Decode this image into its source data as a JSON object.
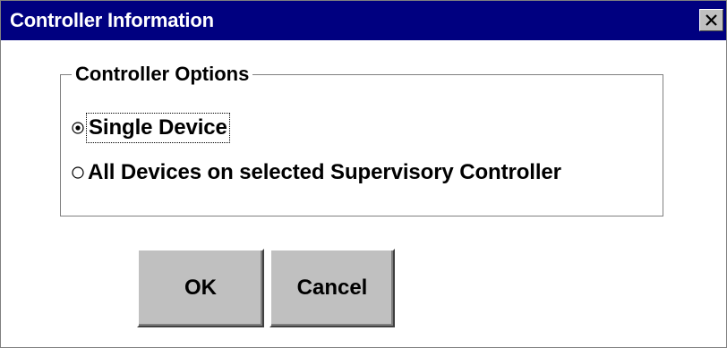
{
  "window": {
    "title": "Controller Information"
  },
  "group": {
    "legend": "Controller Options",
    "options": [
      {
        "label": "Single Device",
        "selected": true
      },
      {
        "label": "All Devices on selected Supervisory Controller",
        "selected": false
      }
    ]
  },
  "buttons": {
    "ok_label": "OK",
    "cancel_label": "Cancel"
  },
  "colors": {
    "titlebar": "#000080",
    "button_face": "#c0c0c0"
  }
}
